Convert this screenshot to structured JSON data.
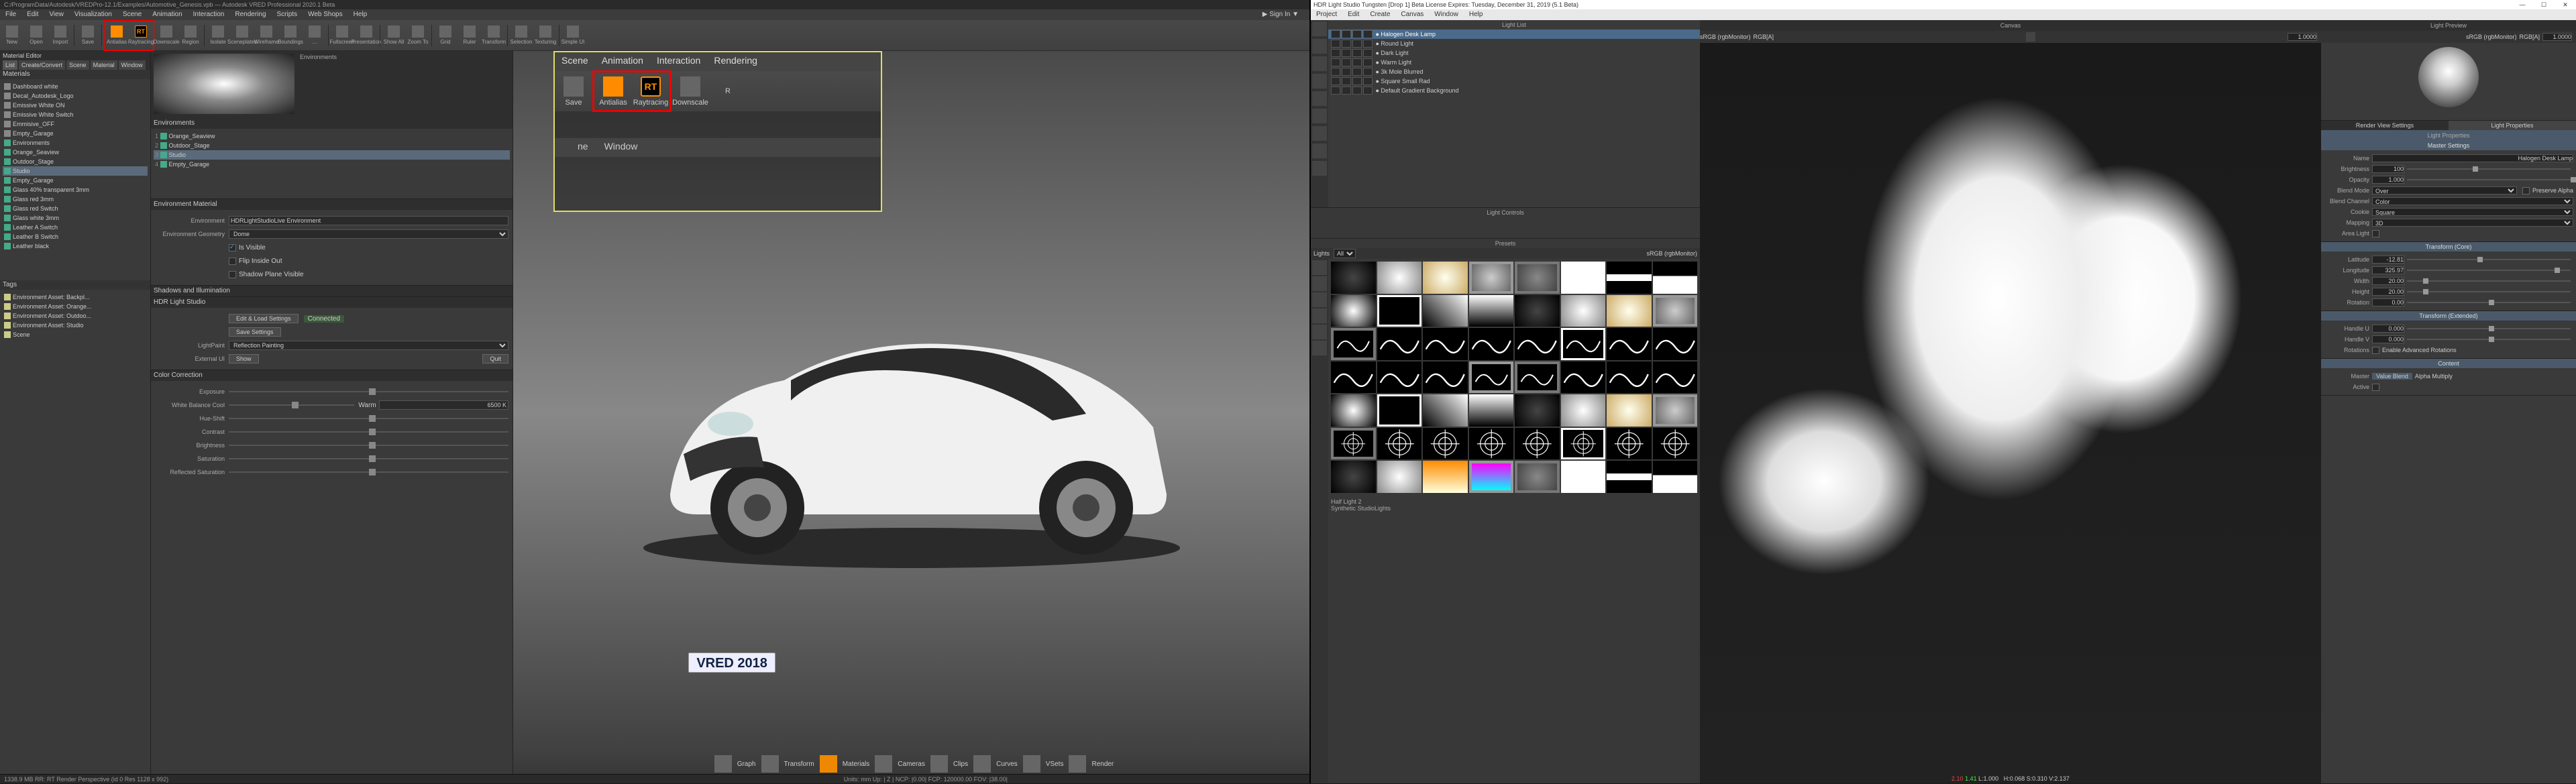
{
  "vred": {
    "title": "C:/ProgramData/Autodesk/VREDPro-12.1/Examples/Automotive_Genesis.vpb — Autodesk VRED Professional 2020.1 Beta",
    "menubar": [
      "File",
      "Edit",
      "View",
      "Visualization",
      "Scene",
      "Animation",
      "Interaction",
      "Rendering",
      "Scripts",
      "Web Shops",
      "Help"
    ],
    "signin": "▶ Sign In  ▼",
    "toolbar": [
      "New",
      "Open",
      "Import",
      "Save",
      "Antialias",
      "Raytracing",
      "Downscale",
      "Region",
      "Isolate",
      "Sceneplates",
      "Wireframe",
      "Boundings",
      "...",
      "Fullscreen",
      "Presentation",
      "Show All",
      "Zoom To",
      "Grid",
      "Ruler",
      "Transform",
      "Selection",
      "Texturing",
      "Simple UI"
    ],
    "mateditor": {
      "title": "Material Editor",
      "tabs": [
        "List",
        "Create/Convert",
        "Scene",
        "Material",
        "Window"
      ],
      "mat_title": "Materials",
      "tree": [
        "Dashboard white",
        "Decal_Autodesk_Logo",
        "Emissive White ON",
        "Emissive White Switch",
        "Emmisive_OFF",
        "Empty_Garage",
        "Environments",
        "  Orange_Seaview",
        "  Outdoor_Stage",
        "  Studio",
        "  Empty_Garage",
        "Glass 40% transparent 3mm",
        "Glass red 3mm",
        "Glass red Switch",
        "Glass white 3mm",
        "Leather A Switch",
        "Leather B Switch",
        "Leather black"
      ],
      "tags_title": "Tags",
      "tags": [
        "Environment Asset: Backpl...",
        "Environment Asset: Orange...",
        "Environment Asset: Outdoo...",
        "Environment Asset: Studio",
        "Scene"
      ],
      "env_tree_title": "Environments",
      "env_tree": [
        "Orange_Seaview",
        "Outdoor_Stage",
        "Studio",
        "Empty_Garage"
      ],
      "preview_hdr": "Environments"
    },
    "envmat": {
      "title": "Environment Material",
      "env_lbl": "Environment",
      "env_val": "HDRLightStudioLive Environment",
      "geom_lbl": "Environment Geometry",
      "geom_val": "Dome",
      "vis_lbl": "Is Visible",
      "flip_lbl": "Flip Inside Out",
      "shadow_lbl": "Shadow Plane Visible"
    },
    "shadows": {
      "title": "Shadows and Illumination"
    },
    "hdrlsbridge": {
      "title": "HDR Light Studio",
      "btn_editload": "Edit & Load Settings",
      "connected": "Connected",
      "btn_save": "Save Settings",
      "lightpaint_lbl": "LightPaint",
      "lightpaint_val": "Reflection Painting",
      "extui_lbl": "External UI",
      "btn_show": "Show",
      "btn_quit": "Quit"
    },
    "cc": {
      "title": "Color Correction",
      "rows": [
        "Exposure",
        "White Balance  Cool",
        "Hue-Shift",
        "Contrast",
        "Brightness",
        "Saturation",
        "Reflected Saturation"
      ],
      "warm": "Warm",
      "warmval": "6500 K"
    },
    "linkbar": [
      "Graph",
      "Transform",
      "Materials",
      "Cameras",
      "Clips",
      "Curves",
      "VSets",
      "Render"
    ],
    "statusbar_left": "1338.9 MB   RR: RT   Render Perspective (id 0 Res 1128 x 992)",
    "statusbar_right": "Units:  mm    Up: | Z |    NCP:  |0.00|    FCP:  120000.00    FOV:  |38.00|",
    "callout": {
      "menu": [
        "Scene",
        "Animation",
        "Interaction",
        "Rendering"
      ],
      "tools": [
        "Save",
        "Antialias",
        "Raytracing",
        "Downscale",
        "R"
      ],
      "menu2": [
        "ne",
        "Window"
      ],
      "rt": "RT"
    },
    "plate": "VRED 2018"
  },
  "hdrls": {
    "title": "HDR Light Studio Tungsten [Drop 1] Beta License Expires: Tuesday, December 31, 2019  (5.1 Beta)",
    "menu": [
      "Project",
      "Edit",
      "Create",
      "Canvas",
      "Window",
      "Help"
    ],
    "lightlist": {
      "title": "Light List",
      "items": [
        "Halogen Desk Lamp",
        "Round Light",
        "Dark Light",
        "Warm Light",
        "3k Mole Blurred",
        "Square Small Rad",
        "Default Gradient Background"
      ]
    },
    "lightctrls_title": "Light Controls",
    "presets_title": "Presets",
    "presets_filter_lbl": "Lights",
    "presets_filter_val": "All",
    "presets_cs": "sRGB (rgbMonitor)",
    "canvas_title": "Canvas",
    "canvas_cs": "sRGB (rgbMonitor)",
    "canvas_mode": "RGB[A]",
    "canvas_gain": "1.0000",
    "canvas_status": "2.10 1.41  L:1.000    H:0.068 S:0.310 V:2.137",
    "selected_preset": "Half Light 2",
    "selected_cat": "Synthetic StudioLights",
    "lightpreview": {
      "title": "Light Preview",
      "cs": "sRGB (rgbMonitor)",
      "mode": "RGB[A]",
      "gain": "1.0000"
    },
    "panelhdrs": {
      "render": "Render View Settings",
      "props": "Light Properties"
    },
    "props": {
      "title": "Light Properties",
      "master": {
        "title": "Master Settings",
        "name_lbl": "Name",
        "name": "Halogen Desk Lamp",
        "bright_lbl": "Brightness",
        "bright": "100",
        "opac_lbl": "Opacity",
        "opac": "1.000",
        "blend_lbl": "Blend Mode",
        "blend": "Over",
        "preserve_lbl": "Preserve Alpha",
        "bchan_lbl": "Blend Channel",
        "bchan": "Color",
        "cookie_lbl": "Cookie",
        "cookie": "Square",
        "map_lbl": "Mapping",
        "map": "3D",
        "area_lbl": "Area Light"
      },
      "tcore": {
        "title": "Transform (Core)",
        "lat_lbl": "Latitude",
        "lat": "-12.81",
        "lon_lbl": "Longitude",
        "lon": "325.97",
        "w_lbl": "Width",
        "w": "20.00",
        "h_lbl": "Height",
        "h": "20.00",
        "rot_lbl": "Rotation",
        "rot": "0.00"
      },
      "text": {
        "title": "Transform (Extended)",
        "hu_lbl": "Handle U",
        "hu": "0.000",
        "hv_lbl": "Handle V",
        "hv": "0.000",
        "rots_lbl": "Rotations",
        "adv_lbl": "Enable Advanced Rotations"
      },
      "content": {
        "title": "Content",
        "master_lbl": "Master",
        "vb": "Value Blend",
        "am": "Alpha Multiply",
        "active_lbl": "Active"
      }
    }
  }
}
